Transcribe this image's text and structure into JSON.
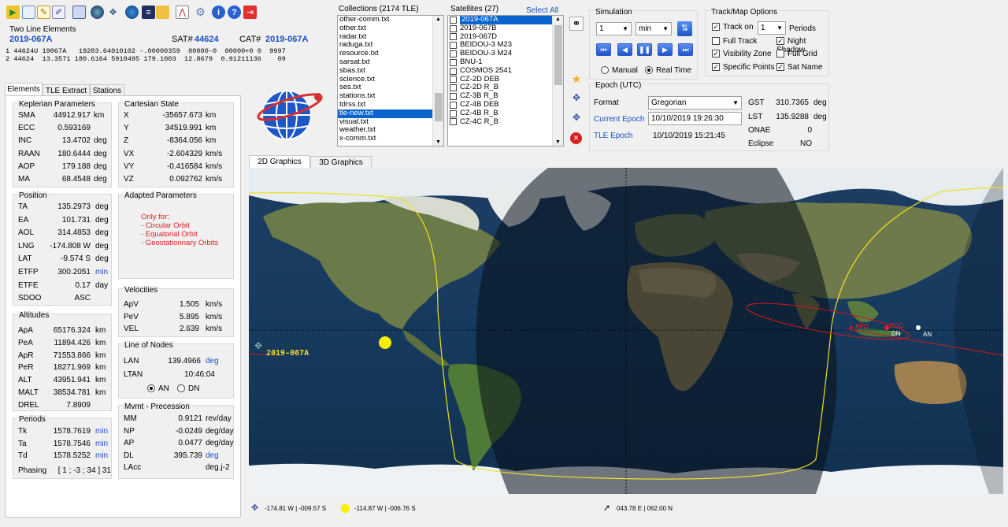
{
  "toolbar": {
    "icons": [
      "open-icon",
      "new-icon",
      "edit-icon",
      "note-icon",
      "list-icon",
      "table-icon",
      "globe-icon",
      "satellite-icon",
      "earth-icon",
      "folder-icon",
      "chart-icon",
      "settings-icon",
      "info-icon",
      "help-icon",
      "exit-icon"
    ]
  },
  "tle": {
    "group_title": "Two Line Elements",
    "name": "2019-067A",
    "sat_label": "SAT#",
    "sat_value": "44624",
    "cat_label": "CAT#",
    "cat_value": "2019-067A",
    "line1": "1 44624U 19067A   19283.64010102 -.00000359  00000-0  00000+0 0  9997",
    "line2": "2 44624  13.3571 180.6164 5910495 179.1003  12.8679  0.91211136    09"
  },
  "left_tabs": [
    "Elements",
    "TLE Extract",
    "Stations"
  ],
  "keplerian": {
    "title": "Keplerian Parameters",
    "rows": [
      {
        "label": "SMA",
        "value": "44912.917",
        "unit": "km"
      },
      {
        "label": "ECC",
        "value": "0.593169",
        "unit": ""
      },
      {
        "label": "INC",
        "value": "13.4702",
        "unit": "deg"
      },
      {
        "label": "RAAN",
        "value": "180.6444",
        "unit": "deg"
      },
      {
        "label": "AOP",
        "value": "179.188",
        "unit": "deg"
      },
      {
        "label": "MA",
        "value": "68.4548",
        "unit": "deg"
      }
    ]
  },
  "cartesian": {
    "title": "Cartesian State",
    "rows": [
      {
        "label": "X",
        "value": "-35657.673",
        "unit": "km"
      },
      {
        "label": "Y",
        "value": "34519.991",
        "unit": "km"
      },
      {
        "label": "Z",
        "value": "-8364.056",
        "unit": "km"
      },
      {
        "label": "VX",
        "value": "-2.604329",
        "unit": "km/s"
      },
      {
        "label": "VY",
        "value": "-0.416584",
        "unit": "km/s"
      },
      {
        "label": "VZ",
        "value": "0.092762",
        "unit": "km/s"
      }
    ]
  },
  "position": {
    "title": "Position",
    "rows": [
      {
        "label": "TA",
        "value": "135.2973",
        "unit": "deg"
      },
      {
        "label": "EA",
        "value": "101.731",
        "unit": "deg"
      },
      {
        "label": "AOL",
        "value": "314.4853",
        "unit": "deg"
      },
      {
        "label": "LNG",
        "value": "-174.808 W",
        "unit": "deg"
      },
      {
        "label": "LAT",
        "value": "-9.574 S",
        "unit": "deg"
      },
      {
        "label": "ETFP",
        "value": "300.2051",
        "unit": "min"
      },
      {
        "label": "ETFE",
        "value": "0.17",
        "unit": "day"
      },
      {
        "label": "SDOO",
        "value": "ASC",
        "unit": ""
      }
    ]
  },
  "adapted": {
    "title": "Adapted Parameters",
    "lines": [
      "Only for:",
      "- Circular Orbit",
      "- Equatorial Orbit",
      "- Geostationnary Orbits"
    ]
  },
  "velocities": {
    "title": "Velocities",
    "rows": [
      {
        "label": "ApV",
        "value": "1.505",
        "unit": "km/s"
      },
      {
        "label": "PeV",
        "value": "5.895",
        "unit": "km/s"
      },
      {
        "label": "VEL",
        "value": "2.639",
        "unit": "km/s"
      }
    ]
  },
  "altitudes": {
    "title": "Altitudes",
    "rows": [
      {
        "label": "ApA",
        "value": "65176.324",
        "unit": "km"
      },
      {
        "label": "PeA",
        "value": "11894.426",
        "unit": "km"
      },
      {
        "label": "ApR",
        "value": "71553.866",
        "unit": "km"
      },
      {
        "label": "PeR",
        "value": "18271.969",
        "unit": "km"
      },
      {
        "label": "ALT",
        "value": "43951.941",
        "unit": "km"
      },
      {
        "label": "MALT",
        "value": "38534.781",
        "unit": "km"
      },
      {
        "label": "DREL",
        "value": "7.8909",
        "unit": ""
      }
    ]
  },
  "nodes": {
    "title": "Line of Nodes",
    "lan_label": "LAN",
    "lan_value": "139.4966",
    "lan_unit": "deg",
    "ltan_label": "LTAN",
    "ltan_value": "10:46:04",
    "an_label": "AN",
    "dn_label": "DN"
  },
  "periods": {
    "title": "Periods",
    "rows": [
      {
        "label": "Tk",
        "value": "1578.7619",
        "unit": "min"
      },
      {
        "label": "Ta",
        "value": "1578.7546",
        "unit": "min"
      },
      {
        "label": "Td",
        "value": "1578.5252",
        "unit": "min"
      }
    ],
    "phasing_label": "Phasing",
    "phasing_value": "[ 1 ; -3 ; 34 ] 31"
  },
  "mvmt": {
    "title": "Mvmt - Precession",
    "rows": [
      {
        "label": "MM",
        "value": "0.9121",
        "unit": "rev/day"
      },
      {
        "label": "NP",
        "value": "-0.0249",
        "unit": "deg/day"
      },
      {
        "label": "AP",
        "value": "0.0477",
        "unit": "deg/day"
      },
      {
        "label": "DL",
        "value": "395.739",
        "unit": "deg"
      },
      {
        "label": "LAcc",
        "value": "",
        "unit": "deg.j-2"
      }
    ]
  },
  "collections": {
    "title": "Collections (2174 TLE)",
    "items": [
      "other-comm.txt",
      "other.txt",
      "radar.txt",
      "raduga.txt",
      "resource.txt",
      "sarsat.txt",
      "sbas.txt",
      "science.txt",
      "ses.txt",
      "stations.txt",
      "tdrss.txt",
      "tle-new.txt",
      "visual.txt",
      "weather.txt",
      "x-comm.txt"
    ],
    "selected": 11
  },
  "satellites": {
    "title": "Satellites (27)",
    "select_all": "Select All",
    "items": [
      "2019-067A",
      "2019-067B",
      "2019-067D",
      "BEIDOU-3 M23",
      "BEIDOU-3 M24",
      "BNU-1",
      "COSMOS 2541",
      "CZ-2D DEB",
      "CZ-2D R_B",
      "CZ-3B R_B",
      "CZ-4B DEB",
      "CZ-4B R_B",
      "CZ-4C R_B"
    ],
    "selected": 0
  },
  "simulation": {
    "title": "Simulation",
    "step_value": "1",
    "unit_value": "min",
    "manual_label": "Manual",
    "realtime_label": "Real Time"
  },
  "track_options": {
    "title": "Track/Map Options",
    "track_on_label": "Track on",
    "periods_value": "1",
    "periods_label": "Periods",
    "full_track": "Full Track",
    "night_shadow": "Night Shadow",
    "visibility_zone": "Visibility Zone",
    "full_grid": "Full Grid",
    "specific_points": "Specific Points",
    "sat_name": "Sat Name",
    "checked": {
      "track_on": true,
      "full_track": false,
      "night_shadow": true,
      "visibility_zone": true,
      "full_grid": false,
      "specific_points": true,
      "sat_name": true
    }
  },
  "epoch": {
    "title": "Epoch (UTC)",
    "format_label": "Format",
    "format_value": "Gregorian",
    "current_label": "Current Epoch",
    "current_value": "10/10/2019 19:26:30",
    "tle_label": "TLE Epoch",
    "tle_value": "10/10/2019 15:21:45",
    "gst_label": "GST",
    "gst_value": "310.7365",
    "gst_unit": "deg",
    "lst_label": "LST",
    "lst_value": "135.9288",
    "lst_unit": "deg",
    "onae_label": "ONAE",
    "onae_value": "0",
    "eclipse_label": "Eclipse",
    "eclipse_value": "NO"
  },
  "graphics_tabs": [
    "2D Graphics",
    "3D Graphics"
  ],
  "map": {
    "sat_name": "2019-067A",
    "pt_an": "AN",
    "pt_dn": "DN",
    "pt_ecc": "ECC",
    "pt_apo": "APO"
  },
  "status": {
    "sat_pos": "-174.81 W | -009.57 S",
    "sun_pos": "-114.87 W | -006.76 S",
    "cursor_pos": "043.78 E | 062.00 N"
  },
  "colors": {
    "accent": "#1a4fc8",
    "track": "#f0e020",
    "selection": "#0a64d0",
    "orbit": "#d01818"
  }
}
